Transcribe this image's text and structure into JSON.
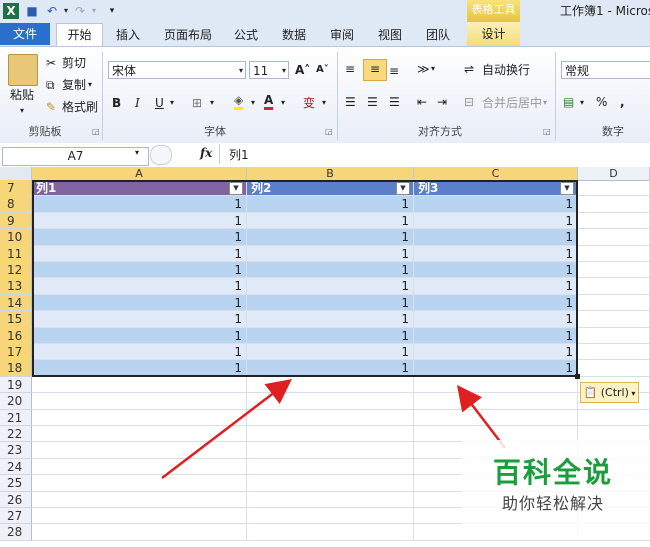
{
  "titlebar": {
    "context_tools": "表格工具",
    "doc_title": "工作簿1 - Micros"
  },
  "tabs": {
    "file": "文件",
    "home": "开始",
    "insert": "插入",
    "page_layout": "页面布局",
    "formulas": "公式",
    "data": "数据",
    "review": "审阅",
    "view": "视图",
    "team": "团队",
    "design": "设计"
  },
  "ribbon": {
    "clipboard": {
      "paste": "粘贴",
      "cut": "剪切",
      "copy": "复制",
      "format_painter": "格式刷",
      "label": "剪贴板"
    },
    "font": {
      "name": "宋体",
      "size": "11",
      "label": "字体"
    },
    "alignment": {
      "wrap": "自动换行",
      "merge": "合并后居中",
      "label": "对齐方式"
    },
    "number": {
      "format": "常规",
      "label": "数字"
    }
  },
  "formula_bar": {
    "name_box": "A7",
    "fx": "fx",
    "content": "列1"
  },
  "columns": [
    "A",
    "B",
    "C",
    "D"
  ],
  "table": {
    "header_row": "7",
    "headers": [
      "列1",
      "列2",
      "列3"
    ],
    "rows": [
      {
        "row": "8",
        "values": [
          "1",
          "1",
          "1"
        ]
      },
      {
        "row": "9",
        "values": [
          "1",
          "1",
          "1"
        ]
      },
      {
        "row": "10",
        "values": [
          "1",
          "1",
          "1"
        ]
      },
      {
        "row": "11",
        "values": [
          "1",
          "1",
          "1"
        ]
      },
      {
        "row": "12",
        "values": [
          "1",
          "1",
          "1"
        ]
      },
      {
        "row": "13",
        "values": [
          "1",
          "1",
          "1"
        ]
      },
      {
        "row": "14",
        "values": [
          "1",
          "1",
          "1"
        ]
      },
      {
        "row": "15",
        "values": [
          "1",
          "1",
          "1"
        ]
      },
      {
        "row": "16",
        "values": [
          "1",
          "1",
          "1"
        ]
      },
      {
        "row": "17",
        "values": [
          "1",
          "1",
          "1"
        ]
      },
      {
        "row": "18",
        "values": [
          "1",
          "1",
          "1"
        ]
      }
    ]
  },
  "empty_rows": [
    "19",
    "20",
    "21",
    "22",
    "23",
    "24",
    "25",
    "26",
    "27",
    "28"
  ],
  "paste_options": "(Ctrl)",
  "watermark": {
    "title": "百科全说",
    "subtitle": "助你轻松解决"
  },
  "colors": {
    "accent": "#2a6fc9",
    "table_header": "#5b7fc8",
    "band": "#b8d4f0",
    "arrow": "#e02020"
  }
}
